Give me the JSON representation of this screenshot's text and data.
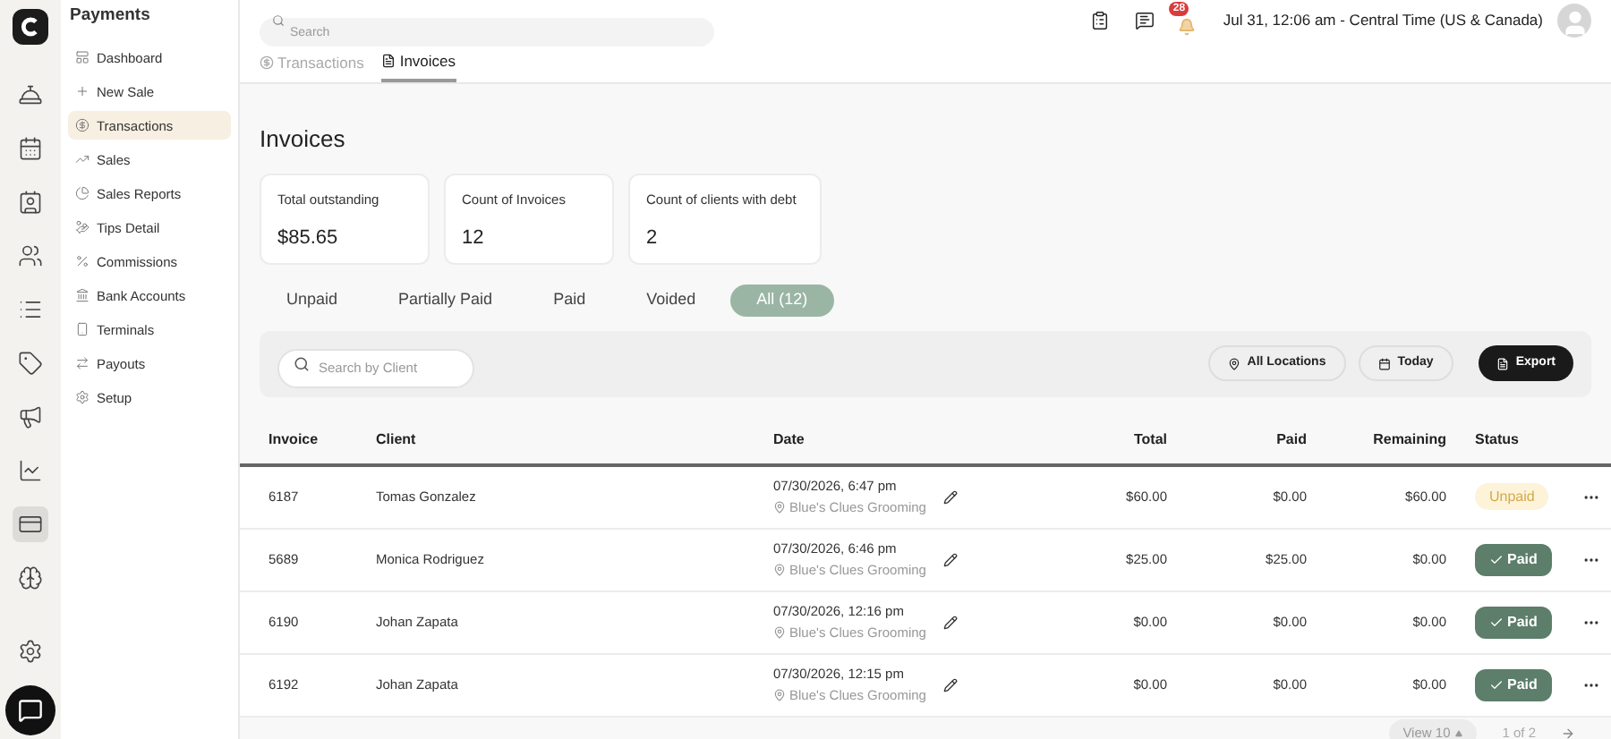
{
  "rail": [
    {
      "selected": false
    },
    {
      "selected": false
    },
    {
      "selected": false
    },
    {
      "selected": false
    },
    {
      "selected": false
    },
    {
      "selected": false
    },
    {
      "selected": false
    },
    {
      "selected": false
    },
    {
      "selected": true
    },
    {
      "selected": false
    }
  ],
  "sidebar": {
    "title": "Payments",
    "items": [
      {
        "label": "Dashboard",
        "selected": false
      },
      {
        "label": "New Sale",
        "selected": false
      },
      {
        "label": "Transactions",
        "selected": true
      },
      {
        "label": "Sales",
        "selected": false
      },
      {
        "label": "Sales Reports",
        "selected": false
      },
      {
        "label": "Tips Detail",
        "selected": false
      },
      {
        "label": "Commissions",
        "selected": false
      },
      {
        "label": "Bank Accounts",
        "selected": false
      },
      {
        "label": "Terminals",
        "selected": false
      },
      {
        "label": "Payouts",
        "selected": false
      },
      {
        "label": "Setup",
        "selected": false
      }
    ]
  },
  "topbar": {
    "search": {
      "placeholder": "Search"
    },
    "notifications": "28",
    "datetime": "Jul 31, 12:06 am - Central Time (US & Canada)"
  },
  "tabs": [
    {
      "label": "Transactions",
      "selected": false
    },
    {
      "label": "Invoices",
      "selected": true
    }
  ],
  "page_title": "Invoices",
  "stats": [
    {
      "label": "Total outstanding",
      "value": "$85.65"
    },
    {
      "label": "Count of Invoices",
      "value": "12"
    },
    {
      "label": "Count of clients with debt",
      "value": "2"
    }
  ],
  "filters": [
    {
      "label": "Unpaid",
      "selected": false
    },
    {
      "label": "Partially Paid",
      "selected": false
    },
    {
      "label": "Paid",
      "selected": false
    },
    {
      "label": "Voided",
      "selected": false
    },
    {
      "label": "All (12)",
      "selected": true
    }
  ],
  "toolbar": {
    "search": {
      "placeholder": "Search by Client"
    },
    "location": "All Locations",
    "date": "Today",
    "export": "Export"
  },
  "table": {
    "columns": [
      "Invoice",
      "Client",
      "Date",
      "Total",
      "Paid",
      "Remaining",
      "Status"
    ],
    "rows": [
      {
        "invoice": "6187",
        "client": "Tomas Gonzalez",
        "date": "07/30/2026, 6:47 pm",
        "location": "Blue's Clues Grooming",
        "total": "$60.00",
        "paid": "$0.00",
        "remaining": "$60.00",
        "status": {
          "kind": "unpaid",
          "label": "Unpaid"
        }
      },
      {
        "invoice": "5689",
        "client": "Monica Rodriguez",
        "date": "07/30/2026, 6:46 pm",
        "location": "Blue's Clues Grooming",
        "total": "$25.00",
        "paid": "$25.00",
        "remaining": "$0.00",
        "status": {
          "kind": "paid",
          "label": "Paid"
        }
      },
      {
        "invoice": "6190",
        "client": "Johan Zapata",
        "date": "07/30/2026, 12:16 pm",
        "location": "Blue's Clues Grooming",
        "total": "$0.00",
        "paid": "$0.00",
        "remaining": "$0.00",
        "status": {
          "kind": "paid",
          "label": "Paid"
        }
      },
      {
        "invoice": "6192",
        "client": "Johan Zapata",
        "date": "07/30/2026, 12:15 pm",
        "location": "Blue's Clues Grooming",
        "total": "$0.00",
        "paid": "$0.00",
        "remaining": "$0.00",
        "status": {
          "kind": "paid",
          "label": "Paid"
        }
      }
    ]
  },
  "pagination": {
    "view": "View 10",
    "page": "1 of 2"
  }
}
